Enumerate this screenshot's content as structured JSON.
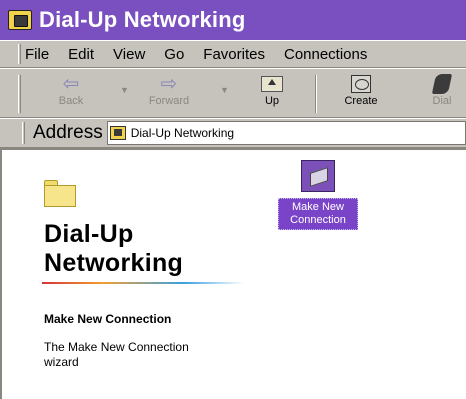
{
  "window": {
    "title": "Dial-Up Networking",
    "title_bar_color": "#7a4fc0"
  },
  "menu": {
    "items": [
      "File",
      "Edit",
      "View",
      "Go",
      "Favorites",
      "Connections"
    ]
  },
  "toolbar": {
    "back_label": "Back",
    "forward_label": "Forward",
    "up_label": "Up",
    "create_label": "Create",
    "dial_label": "Dial",
    "icons": [
      "back-arrow-icon",
      "forward-arrow-icon",
      "up-folder-icon",
      "create-icon",
      "dial-icon"
    ]
  },
  "address": {
    "label": "Address",
    "value": "Dial-Up Networking"
  },
  "sidepanel": {
    "title": "Dial-Up Networking",
    "item_name": "Make New Connection",
    "item_description": "The Make New Connection wizard"
  },
  "files": [
    {
      "name": "Make New Connection",
      "icon": "make-new-connection-icon",
      "selected": true
    }
  ],
  "colors": {
    "selection": "#7a44c8",
    "chrome": "#c6c3bd"
  }
}
